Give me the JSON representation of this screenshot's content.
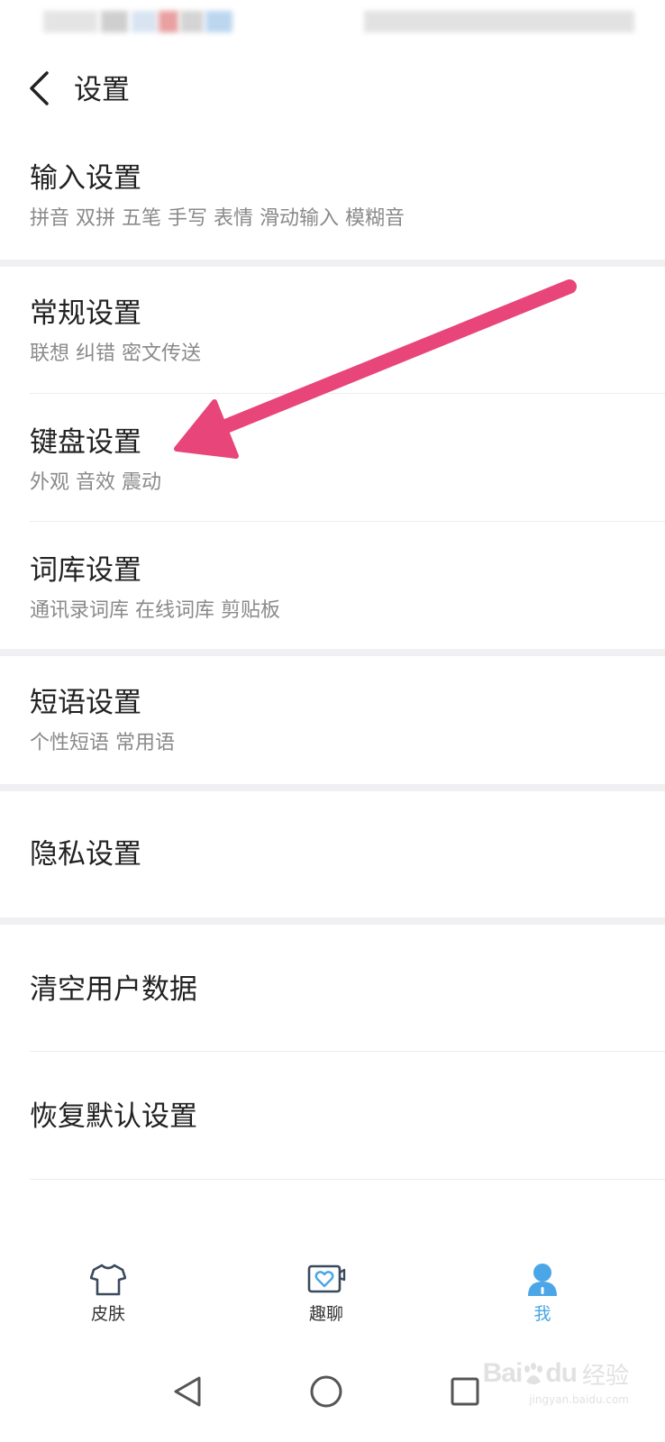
{
  "header": {
    "title": "设置"
  },
  "sections": [
    {
      "title": "输入设置",
      "subtitle": "拼音 双拼 五笔 手写 表情 滑动输入 模糊音"
    },
    {
      "title": "常规设置",
      "subtitle": "联想 纠错 密文传送"
    },
    {
      "title": "键盘设置",
      "subtitle": "外观 音效 震动"
    },
    {
      "title": "词库设置",
      "subtitle": "通讯录词库 在线词库 剪贴板"
    },
    {
      "title": "短语设置",
      "subtitle": "个性短语 常用语"
    },
    {
      "title": "隐私设置"
    },
    {
      "title": "清空用户数据"
    },
    {
      "title": "恢复默认设置"
    }
  ],
  "annotation": {
    "arrow_color": "#e8457a",
    "points_to": "键盘设置"
  },
  "tabbar": {
    "tabs": [
      {
        "label": "皮肤",
        "icon": "tshirt-icon",
        "active": false
      },
      {
        "label": "趣聊",
        "icon": "chat-heart-icon",
        "active": false
      },
      {
        "label": "我",
        "icon": "person-icon",
        "active": true
      }
    ],
    "active_color": "#4aa6e6"
  },
  "navbar": {
    "buttons": [
      "back-triangle-icon",
      "home-circle-icon",
      "recents-square-icon"
    ]
  },
  "watermark": {
    "brand": "Bai",
    "brand_suffix": "du",
    "cn": "经验",
    "url": "jingyan.baidu.com"
  }
}
